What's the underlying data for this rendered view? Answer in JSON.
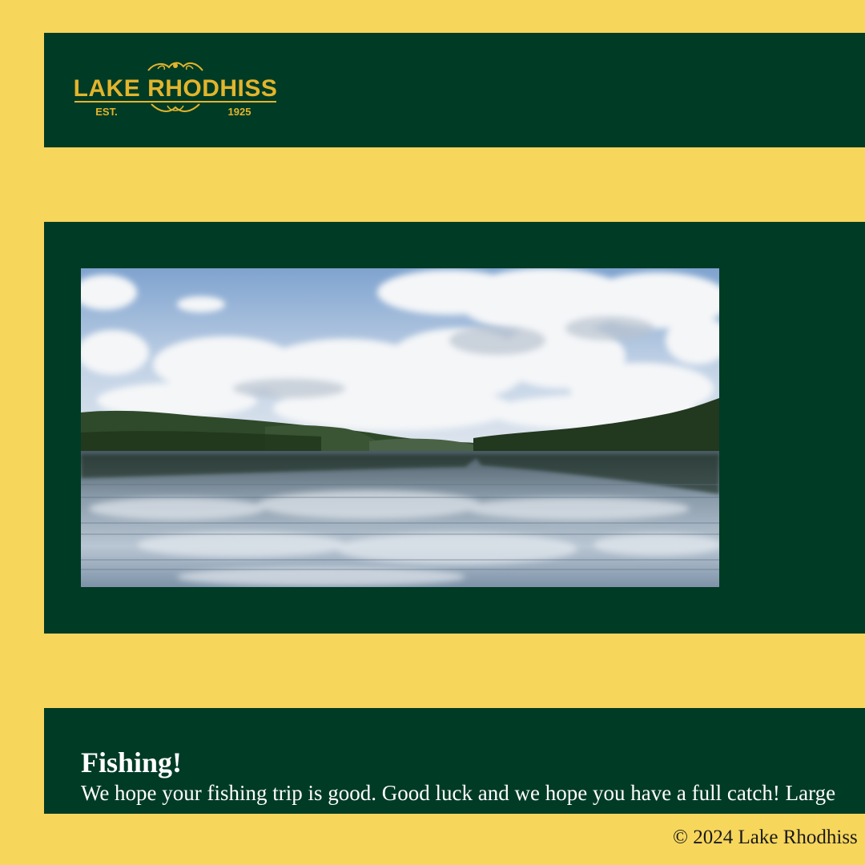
{
  "colors": {
    "page_background": "#f7d65c",
    "panel_green": "#003b26",
    "logo_gold": "#e2b52c",
    "text_white": "#ffffff"
  },
  "header": {
    "logo": {
      "name": "LAKE RHODHISS",
      "est_label": "EST.",
      "year": "1925"
    }
  },
  "hero": {
    "image_icon": "lake-landscape-photo"
  },
  "content": {
    "heading": "Fishing!",
    "body_line_1": "We hope your fishing trip is good. Good luck and we hope you have a full catch! Large"
  },
  "footer": {
    "copyright": "© 2024 Lake Rhodhiss"
  }
}
